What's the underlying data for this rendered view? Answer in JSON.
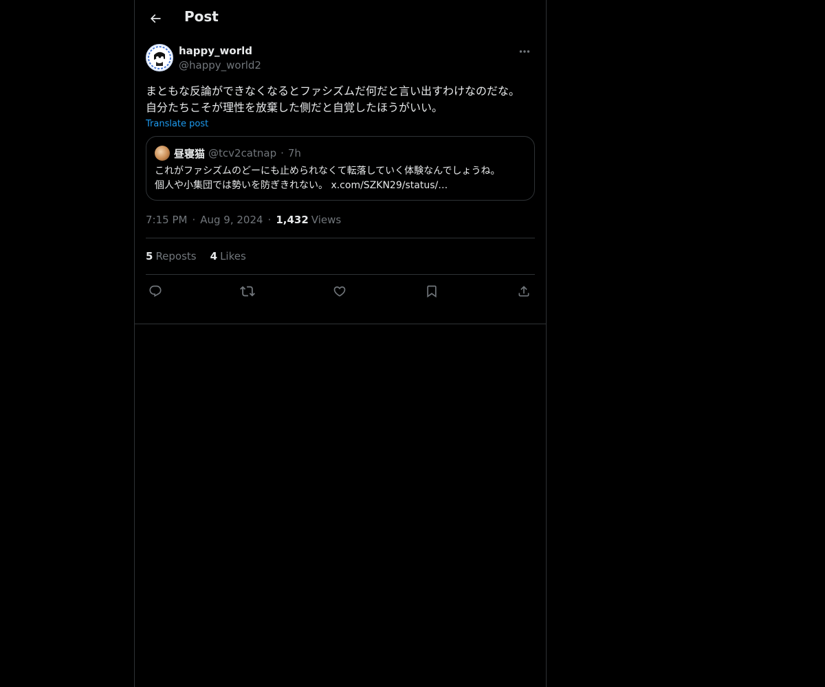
{
  "header": {
    "title": "Post",
    "back_icon": "arrow-left-icon"
  },
  "post": {
    "author": {
      "display_name": "happy_world",
      "handle": "@happy_world2"
    },
    "text": "まともな反論ができなくなるとファシズムだ何だと言い出すわけなのだな。\n自分たちこそが理性を放棄した側だと自覚したほうがいい。",
    "translate_label": "Translate post",
    "quote": {
      "display_name": "昼寝猫",
      "handle": "@tcv2catnap",
      "separator": "·",
      "time": "7h",
      "text": "これがファシズムのどーにも止められなくて転落していく体験なんでしょうね。\n個人や小集団では勢いを防ぎきれない。 x.com/SZKN29/status/…"
    },
    "meta": {
      "time": "7:15 PM",
      "separator": "·",
      "date": "Aug 9, 2024",
      "views_count": "1,432",
      "views_label": "Views"
    },
    "stats": {
      "reposts_count": "5",
      "reposts_label": "Reposts",
      "likes_count": "4",
      "likes_label": "Likes"
    },
    "actions": [
      "reply-icon",
      "repost-icon",
      "like-icon",
      "bookmark-icon",
      "share-icon"
    ]
  },
  "colors": {
    "background": "#000000",
    "text": "#e7e9ea",
    "muted": "#71767b",
    "link": "#1d9bf0",
    "border": "#2f3336"
  }
}
